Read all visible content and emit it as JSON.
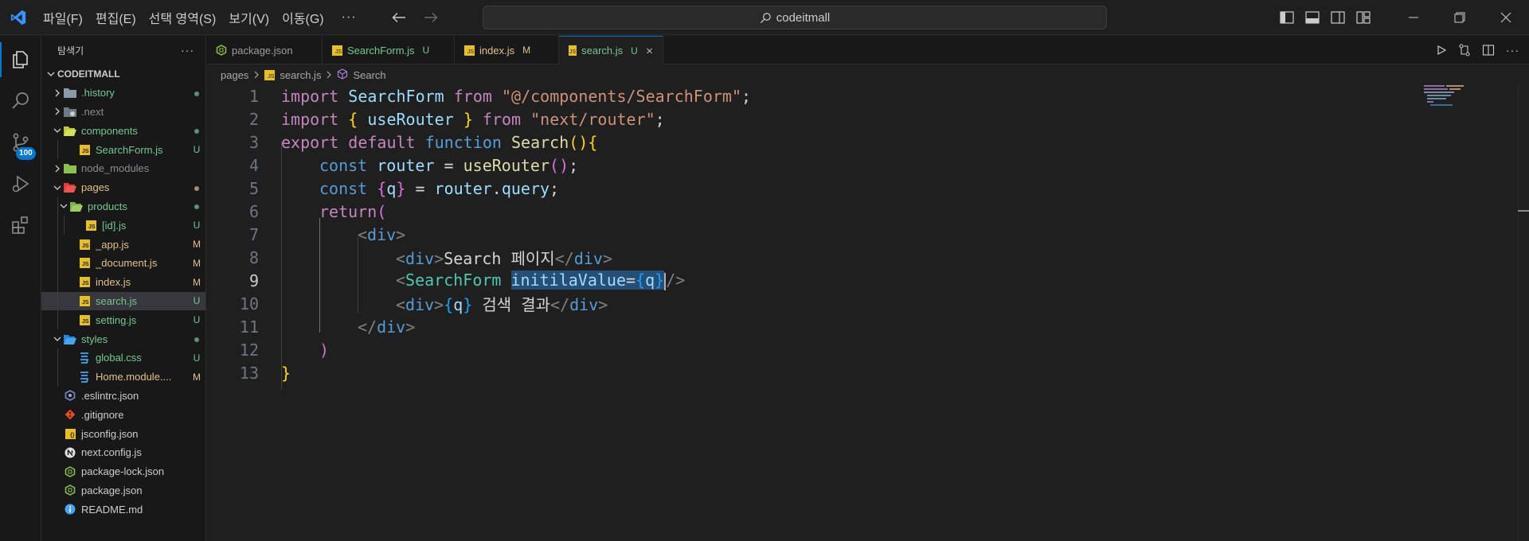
{
  "titlebar": {
    "menu": [
      "파일(F)",
      "편집(E)",
      "선택 영역(S)",
      "보기(V)",
      "이동(G)"
    ],
    "more": "···",
    "search": "codeitmall"
  },
  "activity": {
    "scm_badge": "100"
  },
  "sidebar": {
    "title": "탐색기",
    "more": "···",
    "root": "CODEITMALL",
    "items": [
      {
        "name": ".history",
        "status": "dot"
      },
      {
        "name": ".next",
        "status": ""
      },
      {
        "name": "components",
        "status": "dot"
      },
      {
        "name": "SearchForm.js",
        "status": "U"
      },
      {
        "name": "node_modules",
        "status": ""
      },
      {
        "name": "pages",
        "status": "dot"
      },
      {
        "name": "products",
        "status": "dot"
      },
      {
        "name": "[id].js",
        "status": "U"
      },
      {
        "name": "_app.js",
        "status": "M"
      },
      {
        "name": "_document.js",
        "status": "M"
      },
      {
        "name": "index.js",
        "status": "M"
      },
      {
        "name": "search.js",
        "status": "U"
      },
      {
        "name": "setting.js",
        "status": "U"
      },
      {
        "name": "styles",
        "status": "dot"
      },
      {
        "name": "global.css",
        "status": "U"
      },
      {
        "name": "Home.module....",
        "status": "M"
      },
      {
        "name": ".eslintrc.json",
        "status": ""
      },
      {
        "name": ".gitignore",
        "status": ""
      },
      {
        "name": "jsconfig.json",
        "status": ""
      },
      {
        "name": "next.config.js",
        "status": ""
      },
      {
        "name": "package-lock.json",
        "status": ""
      },
      {
        "name": "package.json",
        "status": ""
      },
      {
        "name": "README.md",
        "status": ""
      }
    ]
  },
  "tabs": [
    {
      "label": "package.json",
      "status": ""
    },
    {
      "label": "SearchForm.js",
      "status": "U"
    },
    {
      "label": "index.js",
      "status": "M"
    },
    {
      "label": "search.js",
      "status": "U"
    }
  ],
  "breadcrumb": [
    "pages",
    "search.js",
    "Search"
  ],
  "editor": {
    "line_numbers": [
      "1",
      "2",
      "3",
      "4",
      "5",
      "6",
      "7",
      "8",
      "9",
      "10",
      "11",
      "12",
      "13"
    ],
    "current_line": 9,
    "lines": {
      "l1": [
        "import",
        " ",
        "SearchForm",
        " ",
        "from",
        " ",
        "\"@/components/SearchForm\"",
        ";"
      ],
      "l2": [
        "import",
        " ",
        "{",
        " ",
        "useRouter",
        " ",
        "}",
        " ",
        "from",
        " ",
        "\"next/router\"",
        ";"
      ],
      "l3": [
        "export",
        " ",
        "default",
        " ",
        "function",
        " ",
        "Search",
        "(",
        ")",
        "{"
      ],
      "l4": [
        "const",
        " ",
        "router",
        " = ",
        "useRouter",
        "(",
        ")",
        ";"
      ],
      "l5": [
        "const",
        " ",
        "{",
        "q",
        "}",
        " = ",
        "router",
        ".",
        "query",
        ";"
      ],
      "l6": [
        "return",
        "("
      ],
      "l7": [
        "<",
        "div",
        ">"
      ],
      "l8": [
        "<",
        "div",
        ">",
        "Search 페이지",
        "</",
        "div",
        ">"
      ],
      "l9": [
        "<",
        "SearchForm",
        " ",
        "initilaValue",
        "=",
        "{",
        "q",
        "}",
        "/>"
      ],
      "l10": [
        "<",
        "div",
        ">",
        "{",
        "q",
        "}",
        " 검색 결과",
        "</",
        "div",
        ">"
      ],
      "l11": [
        "</",
        "div",
        ">"
      ],
      "l12": [
        ")"
      ],
      "l13": [
        "}"
      ]
    }
  }
}
